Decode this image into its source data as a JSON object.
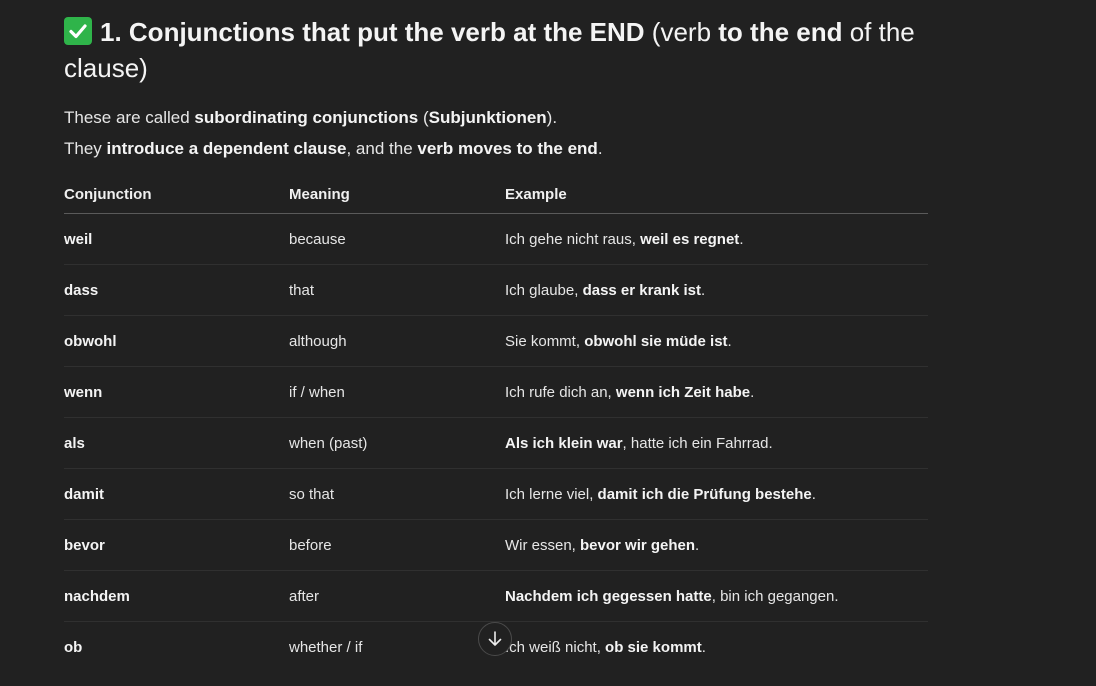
{
  "heading": {
    "icon": "white-check-mark-icon",
    "bold_part": "1. Conjunctions that put the verb at the END",
    "paren_open": " (verb ",
    "paren_bold": "to the end",
    "paren_close": " of the clause)"
  },
  "intro": {
    "line1": {
      "a": "These are called ",
      "b": "subordinating conjunctions",
      "c": " (",
      "d": "Subjunktionen",
      "e": ")."
    },
    "line2": {
      "a": "They ",
      "b": "introduce a dependent clause",
      "c": ", and the ",
      "d": "verb moves to the end",
      "e": "."
    }
  },
  "table": {
    "headers": [
      "Conjunction",
      "Meaning",
      "Example"
    ],
    "rows": [
      {
        "conj": "weil",
        "meaning": "because",
        "ex_a": "Ich gehe nicht raus, ",
        "ex_b": "weil es regnet",
        "ex_c": "."
      },
      {
        "conj": "dass",
        "meaning": "that",
        "ex_a": "Ich glaube, ",
        "ex_b": "dass er krank ist",
        "ex_c": "."
      },
      {
        "conj": "obwohl",
        "meaning": "although",
        "ex_a": "Sie kommt, ",
        "ex_b": "obwohl sie müde ist",
        "ex_c": "."
      },
      {
        "conj": "wenn",
        "meaning": "if / when",
        "ex_a": "Ich rufe dich an, ",
        "ex_b": "wenn ich Zeit habe",
        "ex_c": "."
      },
      {
        "conj": "als",
        "meaning": "when (past)",
        "ex_a": "",
        "ex_b": "Als ich klein war",
        "ex_c": ", hatte ich ein Fahrrad."
      },
      {
        "conj": "damit",
        "meaning": "so that",
        "ex_a": "Ich lerne viel, ",
        "ex_b": "damit ich die Prüfung bestehe",
        "ex_c": "."
      },
      {
        "conj": "bevor",
        "meaning": "before",
        "ex_a": "Wir essen, ",
        "ex_b": "bevor wir gehen",
        "ex_c": "."
      },
      {
        "conj": "nachdem",
        "meaning": "after",
        "ex_a": "",
        "ex_b": "Nachdem ich gegessen hatte",
        "ex_c": ", bin ich gegangen."
      },
      {
        "conj": "ob",
        "meaning": "whether / if",
        "ex_a": "Ich weiß nicht, ",
        "ex_b": "ob sie kommt",
        "ex_c": "."
      }
    ]
  },
  "scroll_button": {
    "icon": "arrow-down-icon"
  }
}
